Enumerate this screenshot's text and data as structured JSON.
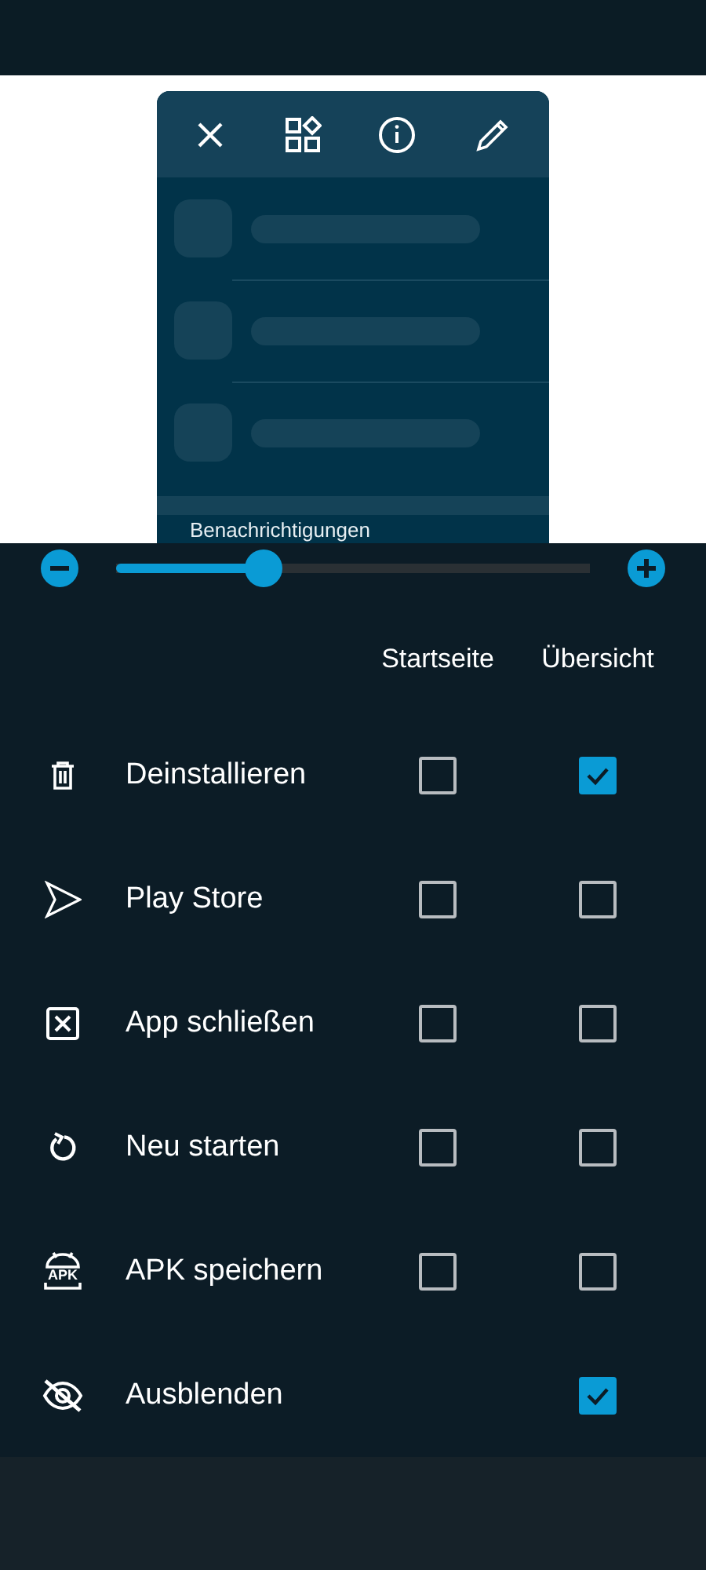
{
  "preview": {
    "toolbar": [
      {
        "kind": "close"
      },
      {
        "kind": "widgets"
      },
      {
        "kind": "info"
      },
      {
        "kind": "edit"
      }
    ],
    "section_label": "Benachrichtigungen"
  },
  "size_slider": {
    "level": 0.31
  },
  "columns": [
    "Startseite",
    "Übersicht"
  ],
  "actions": [
    {
      "kind": "trash",
      "label": "Deinstallieren",
      "startseite": false,
      "uebersicht": true
    },
    {
      "kind": "store",
      "label": "Play Store",
      "startseite": false,
      "uebersicht": false
    },
    {
      "kind": "close",
      "label": "App schließen",
      "startseite": false,
      "uebersicht": false
    },
    {
      "kind": "restart",
      "label": "Neu starten",
      "startseite": false,
      "uebersicht": false
    },
    {
      "kind": "apk",
      "icon_text": "APK",
      "label": "APK speichern",
      "startseite": false,
      "uebersicht": false
    },
    {
      "kind": "hide",
      "label": "Ausblenden",
      "uebersicht": true
    }
  ]
}
